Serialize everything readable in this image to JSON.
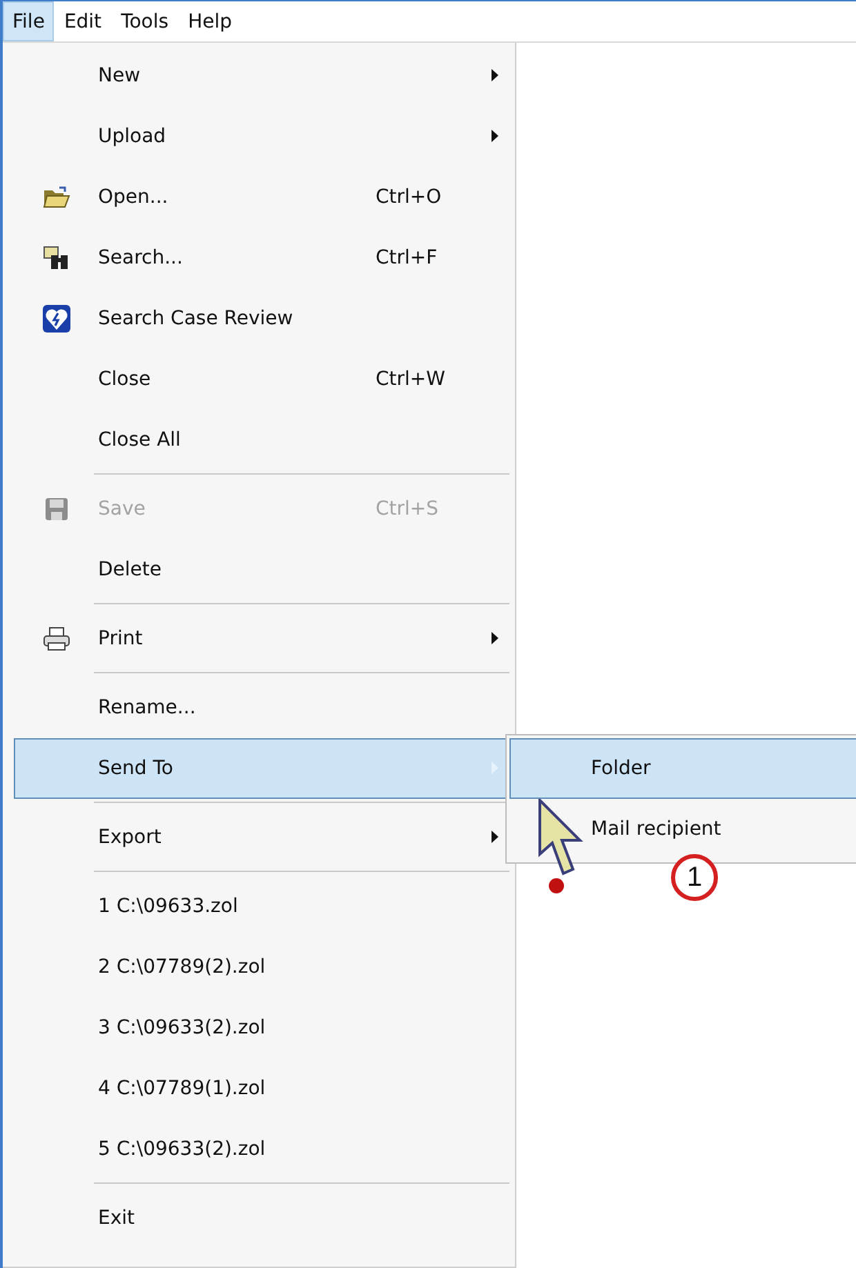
{
  "menubar": [
    {
      "label": "File",
      "selected": true
    },
    {
      "label": "Edit",
      "selected": false
    },
    {
      "label": "Tools",
      "selected": false
    },
    {
      "label": "Help",
      "selected": false
    }
  ],
  "menu": [
    {
      "kind": "item",
      "label": "New",
      "submenu": true,
      "disabled": false,
      "selected": false
    },
    {
      "kind": "item",
      "label": "Upload",
      "submenu": true,
      "disabled": false,
      "selected": false
    },
    {
      "kind": "item",
      "label": "Open...",
      "shortcut": "Ctrl+O",
      "submenu": false,
      "disabled": false,
      "selected": false
    },
    {
      "kind": "item",
      "label": "Search...",
      "shortcut": "Ctrl+F",
      "submenu": false,
      "disabled": false,
      "selected": false
    },
    {
      "kind": "item",
      "label": "Search Case Review",
      "submenu": false,
      "disabled": false,
      "selected": false
    },
    {
      "kind": "item",
      "label": "Close",
      "shortcut": "Ctrl+W",
      "submenu": false,
      "disabled": false,
      "selected": false
    },
    {
      "kind": "item",
      "label": "Close All",
      "submenu": false,
      "disabled": false,
      "selected": false
    },
    {
      "kind": "separator"
    },
    {
      "kind": "item",
      "label": "Save",
      "shortcut": "Ctrl+S",
      "submenu": false,
      "disabled": true,
      "selected": false
    },
    {
      "kind": "item",
      "label": "Delete",
      "submenu": false,
      "disabled": false,
      "selected": false
    },
    {
      "kind": "separator"
    },
    {
      "kind": "item",
      "label": "Print",
      "submenu": true,
      "disabled": false,
      "selected": false
    },
    {
      "kind": "separator"
    },
    {
      "kind": "item",
      "label": "Rename...",
      "submenu": false,
      "disabled": false,
      "selected": false
    },
    {
      "kind": "item",
      "label": "Send To",
      "submenu": true,
      "disabled": false,
      "selected": true,
      "children": [
        {
          "label": "Folder",
          "selected": true
        },
        {
          "label": "Mail recipient",
          "selected": false
        }
      ],
      "callout": "1"
    },
    {
      "kind": "separator"
    },
    {
      "kind": "item",
      "label": "Export",
      "submenu": true,
      "disabled": false,
      "selected": false
    },
    {
      "kind": "separator"
    },
    {
      "kind": "item",
      "label": "1 C:\\09633.zol",
      "submenu": false,
      "disabled": false,
      "selected": false
    },
    {
      "kind": "item",
      "label": "2 C:\\07789(2).zol",
      "submenu": false,
      "disabled": false,
      "selected": false
    },
    {
      "kind": "item",
      "label": "3 C:\\09633(2).zol",
      "submenu": false,
      "disabled": false,
      "selected": false
    },
    {
      "kind": "item",
      "label": "4 C:\\07789(1).zol",
      "submenu": false,
      "disabled": false,
      "selected": false
    },
    {
      "kind": "item",
      "label": "5 C:\\09633(2).zol",
      "submenu": false,
      "disabled": false,
      "selected": false
    },
    {
      "kind": "separator"
    },
    {
      "kind": "item",
      "label": "Exit",
      "submenu": false,
      "disabled": false,
      "selected": false
    }
  ]
}
